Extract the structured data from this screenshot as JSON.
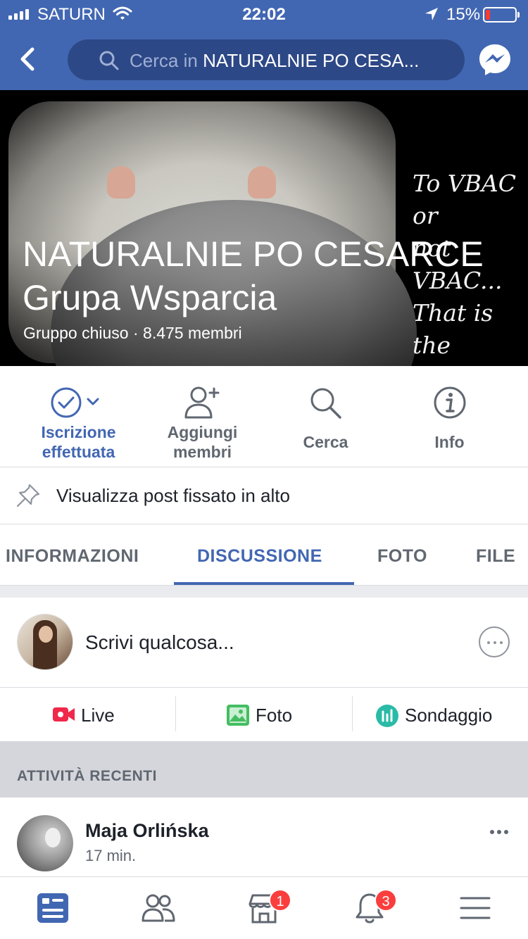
{
  "status_bar": {
    "carrier": "SATURN",
    "time": "22:02",
    "battery_percent": "15%",
    "battery_level": 0.15,
    "battery_color": "#ff3b30"
  },
  "header": {
    "back_icon": "chevron-left-icon",
    "search_prefix": "Cerca in",
    "search_target": "NATURALNIE PO CESA...",
    "messenger_icon": "messenger-icon",
    "color": "#4267b2"
  },
  "cover": {
    "title": "NATURALNIE PO CESARCE Grupa Wsparcia",
    "subtitle": "Gruppo chiuso · 8.475 membri",
    "quote": "To VBAC or\nnot VBAC...\nThat is the\nquestion."
  },
  "actions": [
    {
      "label": "Iscrizione effettuata",
      "icon": "joined-check-icon"
    },
    {
      "label": "Aggiungi membri",
      "icon": "add-member-icon"
    },
    {
      "label": "Cerca",
      "icon": "search-icon"
    },
    {
      "label": "Info",
      "icon": "info-icon"
    }
  ],
  "pinned": {
    "label": "Visualizza post fissato in alto",
    "icon": "pin-icon"
  },
  "tabs": [
    {
      "label": "INFORMAZIONI",
      "active": false
    },
    {
      "label": "DISCUSSIONE",
      "active": true
    },
    {
      "label": "FOTO",
      "active": false
    },
    {
      "label": "FILE",
      "active": false
    }
  ],
  "composer": {
    "placeholder": "Scrivi qualcosa...",
    "quick_actions": [
      {
        "label": "Live",
        "icon": "live-video-icon",
        "color": "#f02849"
      },
      {
        "label": "Foto",
        "icon": "photo-icon",
        "color": "#45bd62"
      },
      {
        "label": "Sondaggio",
        "icon": "poll-icon",
        "color": "#2abba7"
      }
    ]
  },
  "recent_section": {
    "label": "ATTIVITÀ RECENTI"
  },
  "post": {
    "author": "Maja Orlińska",
    "time": "17 min."
  },
  "bottom_tabs": [
    {
      "icon": "news-feed-icon",
      "active": true
    },
    {
      "icon": "friends-icon",
      "active": false
    },
    {
      "icon": "marketplace-icon",
      "badge": "1"
    },
    {
      "icon": "notifications-icon",
      "badge": "3"
    },
    {
      "icon": "menu-icon",
      "active": false
    }
  ]
}
